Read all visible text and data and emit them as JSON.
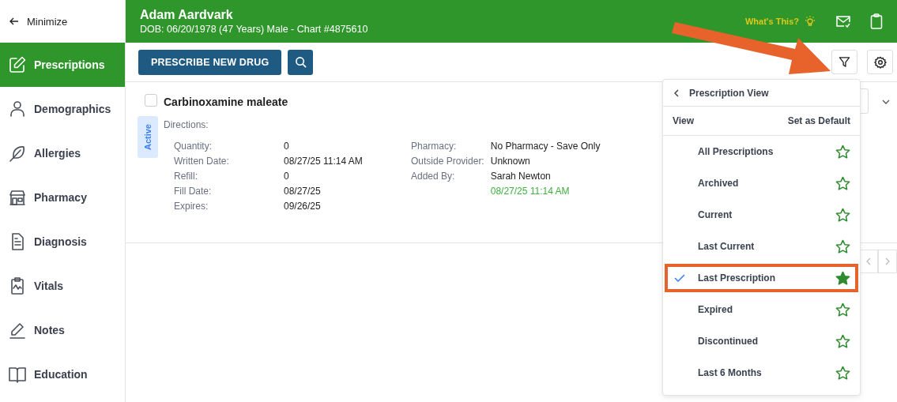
{
  "sidebar": {
    "minimize": "Minimize",
    "items": [
      {
        "label": "Prescriptions",
        "selected": true
      },
      {
        "label": "Demographics",
        "selected": false
      },
      {
        "label": "Allergies",
        "selected": false
      },
      {
        "label": "Pharmacy",
        "selected": false
      },
      {
        "label": "Diagnosis",
        "selected": false
      },
      {
        "label": "Vitals",
        "selected": false
      },
      {
        "label": "Notes",
        "selected": false
      },
      {
        "label": "Education",
        "selected": false
      }
    ]
  },
  "header": {
    "patient_name": "Adam Aardvark",
    "patient_info": "DOB: 06/20/1978 (47 Years) Male - Chart #4875610",
    "help_link": "What's This?"
  },
  "toolbar": {
    "primary_button": "PRESCRIBE NEW DRUG"
  },
  "prescription": {
    "checked": false,
    "drug": "Carbinoxamine maleate",
    "status": "Active",
    "directions_label": "Directions:",
    "left_fields": [
      {
        "label": "Quantity:",
        "value": "0"
      },
      {
        "label": "Written Date:",
        "value": "08/27/25 11:14 AM"
      },
      {
        "label": "Refill:",
        "value": "0"
      },
      {
        "label": "Fill Date:",
        "value": "08/27/25"
      },
      {
        "label": "Expires:",
        "value": "09/26/25"
      }
    ],
    "right_fields": [
      {
        "label": "Pharmacy:",
        "value": "No Pharmacy - Save Only"
      },
      {
        "label": "Outside Provider:",
        "value": "Unknown"
      },
      {
        "label": "Added By:",
        "value": "Sarah Newton",
        "timestamp": "08/27/25 11:14 AM"
      }
    ]
  },
  "view_menu": {
    "title": "Prescription View",
    "column_1": "View",
    "column_2": "Set as Default",
    "items": [
      {
        "label": "All Prescriptions",
        "selected": false,
        "default": false,
        "highlighted": false
      },
      {
        "label": "Archived",
        "selected": false,
        "default": false,
        "highlighted": false
      },
      {
        "label": "Current",
        "selected": false,
        "default": false,
        "highlighted": false
      },
      {
        "label": "Last Current",
        "selected": false,
        "default": false,
        "highlighted": false
      },
      {
        "label": "Last Prescription",
        "selected": true,
        "default": true,
        "highlighted": true
      },
      {
        "label": "Expired",
        "selected": false,
        "default": false,
        "highlighted": false
      },
      {
        "label": "Discontinued",
        "selected": false,
        "default": false,
        "highlighted": false
      },
      {
        "label": "Last 6 Months",
        "selected": false,
        "default": false,
        "highlighted": false
      }
    ]
  }
}
